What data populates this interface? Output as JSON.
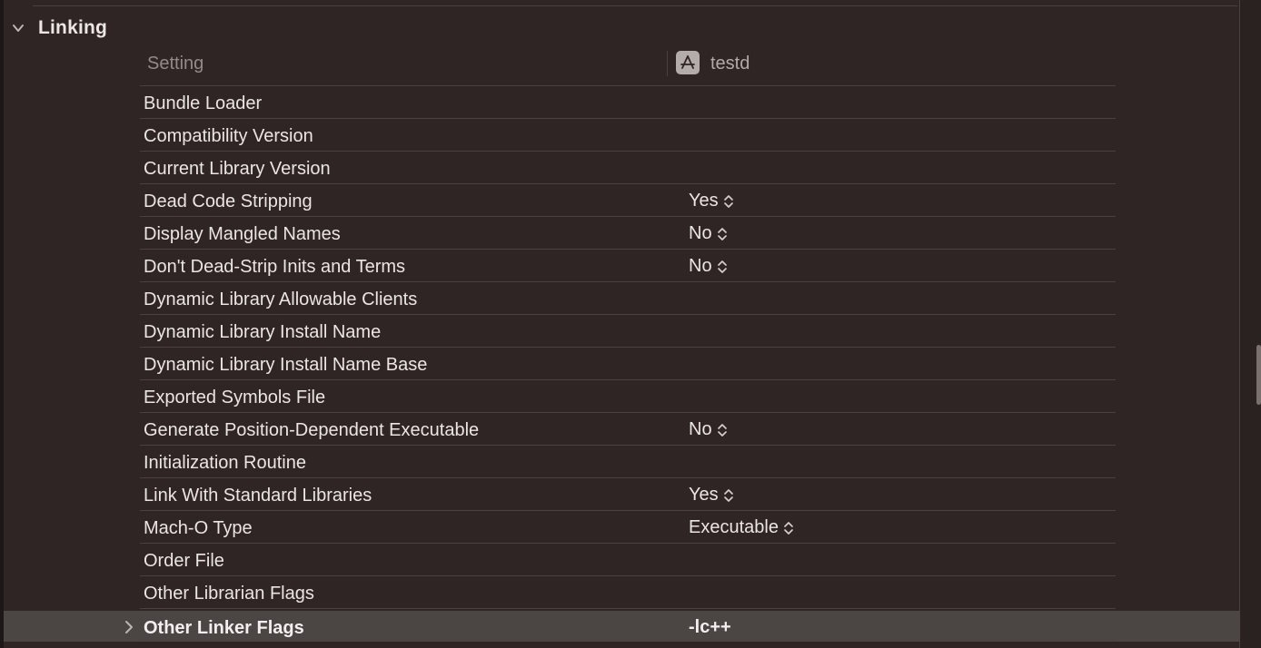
{
  "section": {
    "title": "Linking"
  },
  "header": {
    "setting_label": "Setting",
    "target_name": "testd"
  },
  "rows": [
    {
      "name": "Bundle Loader",
      "value": ""
    },
    {
      "name": "Compatibility Version",
      "value": ""
    },
    {
      "name": "Current Library Version",
      "value": ""
    },
    {
      "name": "Dead Code Stripping",
      "value": "Yes"
    },
    {
      "name": "Display Mangled Names",
      "value": "No"
    },
    {
      "name": "Don't Dead-Strip Inits and Terms",
      "value": "No"
    },
    {
      "name": "Dynamic Library Allowable Clients",
      "value": ""
    },
    {
      "name": "Dynamic Library Install Name",
      "value": ""
    },
    {
      "name": "Dynamic Library Install Name Base",
      "value": ""
    },
    {
      "name": "Exported Symbols File",
      "value": ""
    },
    {
      "name": "Generate Position-Dependent Executable",
      "value": "No"
    },
    {
      "name": "Initialization Routine",
      "value": ""
    },
    {
      "name": "Link With Standard Libraries",
      "value": "Yes"
    },
    {
      "name": "Mach-O Type",
      "value": "Executable"
    },
    {
      "name": "Order File",
      "value": ""
    },
    {
      "name": "Other Librarian Flags",
      "value": ""
    }
  ],
  "selected_row": {
    "name": "Other Linker Flags",
    "value": "-lc++"
  },
  "icons": {
    "section_toggle": "chevron-down-icon",
    "target": "app-target-icon",
    "stepper": "up-down-stepper-icon",
    "expand": "chevron-right-icon"
  },
  "colors": {
    "background": "#2e2524",
    "selected_row": "#4b4544",
    "separator": "#4a403f",
    "text": "#ebe5e3",
    "muted_text": "#948b89"
  }
}
